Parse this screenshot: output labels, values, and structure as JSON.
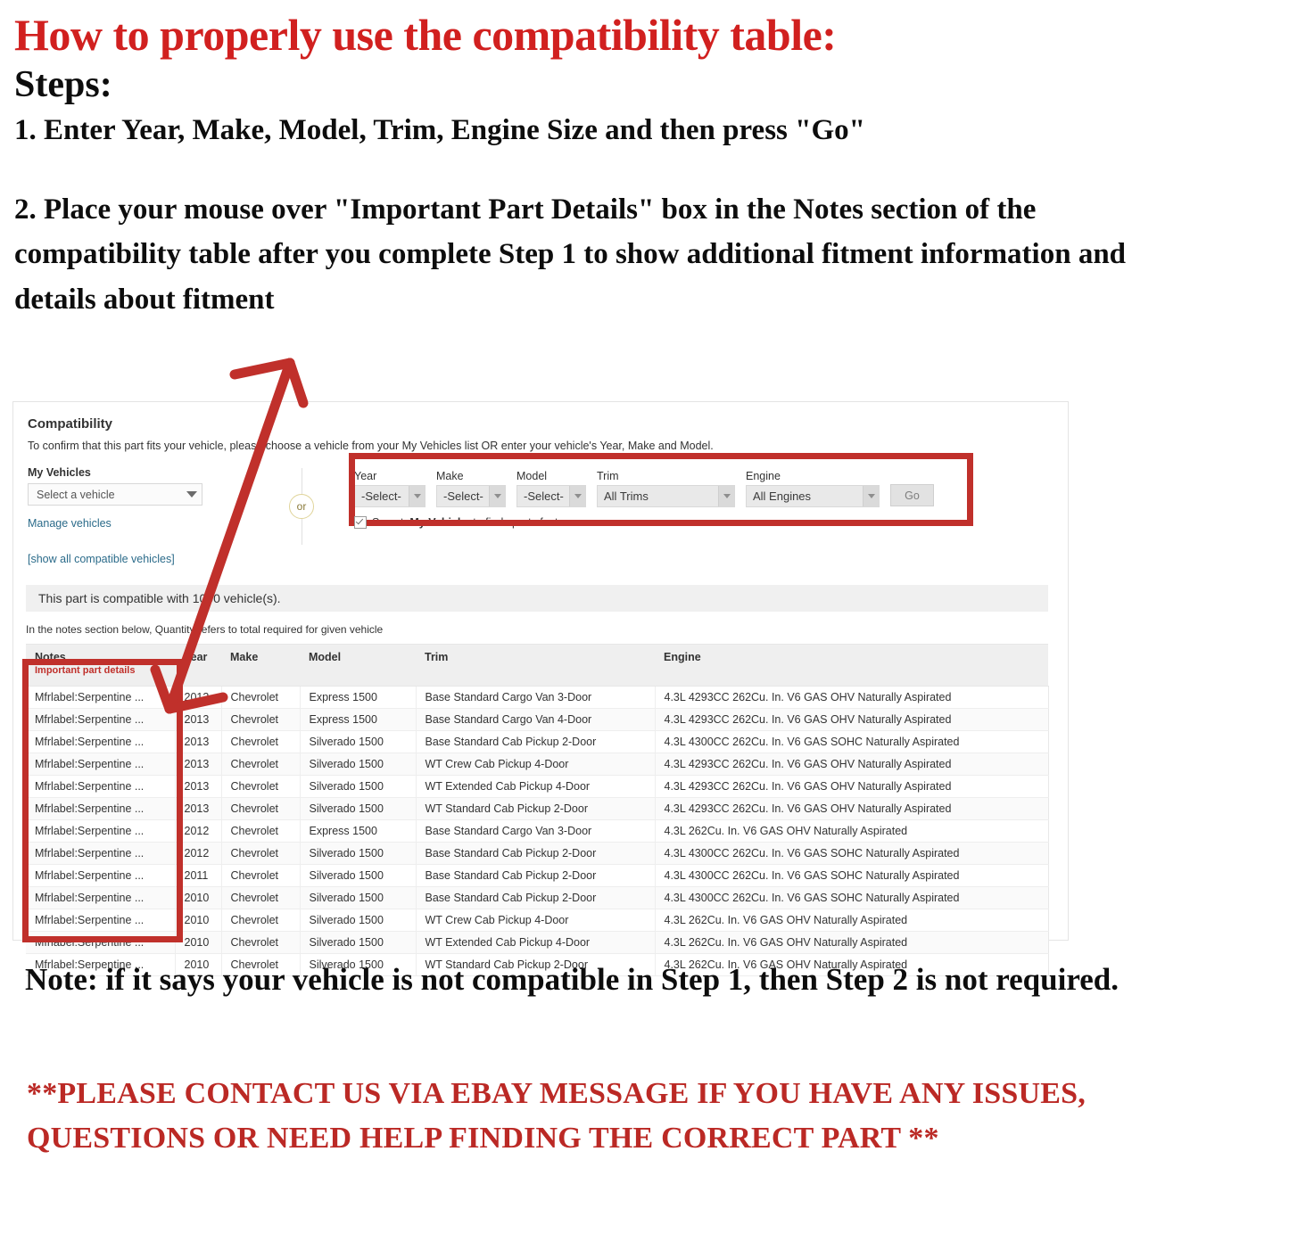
{
  "instructions": {
    "heading": "How to properly use the compatibility table:",
    "steps_label": "Steps:",
    "step1": "1. Enter Year, Make, Model, Trim, Engine Size and then press \"Go\"",
    "step2": "2. Place your mouse over \"Important Part Details\" box in the Notes section of the compatibility table after you complete Step 1 to show additional fitment information and details about fitment"
  },
  "compat": {
    "title": "Compatibility",
    "subtitle": "To confirm that this part fits your vehicle, please choose a vehicle from your My Vehicles list OR enter your vehicle's Year, Make and Model.",
    "my_vehicles_label": "My Vehicles",
    "my_vehicles_value": "Select a vehicle",
    "manage_vehicles_link": "Manage vehicles",
    "show_all_link": "[show all compatible vehicles]",
    "or_label": "or",
    "fields": {
      "year": {
        "label": "Year",
        "value": "-Select-"
      },
      "make": {
        "label": "Make",
        "value": "-Select-"
      },
      "model": {
        "label": "Model",
        "value": "-Select-"
      },
      "trim": {
        "label": "Trim",
        "value": "All Trims"
      },
      "engine": {
        "label": "Engine",
        "value": "All Engines"
      }
    },
    "go_button": "Go",
    "save_checkbox": {
      "prefix": "Save to ",
      "bold": "My Vehicles",
      "suffix": " to finds parts faster",
      "checked": true
    },
    "compatible_bar": "This part is compatible with 1000 vehicle(s).",
    "notes_hint": "In the notes section below, Quantity refers to total required for given vehicle",
    "table": {
      "columns": [
        "Notes",
        "Year",
        "Make",
        "Model",
        "Trim",
        "Engine"
      ],
      "notes_subheader": "Important part details",
      "rows": [
        {
          "notes": "Mfrlabel:Serpentine ...",
          "year": "2013",
          "make": "Chevrolet",
          "model": "Express 1500",
          "trim": "Base Standard Cargo Van 3-Door",
          "engine": "4.3L 4293CC 262Cu. In. V6 GAS OHV Naturally Aspirated"
        },
        {
          "notes": "Mfrlabel:Serpentine ...",
          "year": "2013",
          "make": "Chevrolet",
          "model": "Express 1500",
          "trim": "Base Standard Cargo Van 4-Door",
          "engine": "4.3L 4293CC 262Cu. In. V6 GAS OHV Naturally Aspirated"
        },
        {
          "notes": "Mfrlabel:Serpentine ...",
          "year": "2013",
          "make": "Chevrolet",
          "model": "Silverado 1500",
          "trim": "Base Standard Cab Pickup 2-Door",
          "engine": "4.3L 4300CC 262Cu. In. V6 GAS SOHC Naturally Aspirated"
        },
        {
          "notes": "Mfrlabel:Serpentine ...",
          "year": "2013",
          "make": "Chevrolet",
          "model": "Silverado 1500",
          "trim": "WT Crew Cab Pickup 4-Door",
          "engine": "4.3L 4293CC 262Cu. In. V6 GAS OHV Naturally Aspirated"
        },
        {
          "notes": "Mfrlabel:Serpentine ...",
          "year": "2013",
          "make": "Chevrolet",
          "model": "Silverado 1500",
          "trim": "WT Extended Cab Pickup 4-Door",
          "engine": "4.3L 4293CC 262Cu. In. V6 GAS OHV Naturally Aspirated"
        },
        {
          "notes": "Mfrlabel:Serpentine ...",
          "year": "2013",
          "make": "Chevrolet",
          "model": "Silverado 1500",
          "trim": "WT Standard Cab Pickup 2-Door",
          "engine": "4.3L 4293CC 262Cu. In. V6 GAS OHV Naturally Aspirated"
        },
        {
          "notes": "Mfrlabel:Serpentine ...",
          "year": "2012",
          "make": "Chevrolet",
          "model": "Express 1500",
          "trim": "Base Standard Cargo Van 3-Door",
          "engine": "4.3L 262Cu. In. V6 GAS OHV Naturally Aspirated"
        },
        {
          "notes": "Mfrlabel:Serpentine ...",
          "year": "2012",
          "make": "Chevrolet",
          "model": "Silverado 1500",
          "trim": "Base Standard Cab Pickup 2-Door",
          "engine": "4.3L 4300CC 262Cu. In. V6 GAS SOHC Naturally Aspirated"
        },
        {
          "notes": "Mfrlabel:Serpentine ...",
          "year": "2011",
          "make": "Chevrolet",
          "model": "Silverado 1500",
          "trim": "Base Standard Cab Pickup 2-Door",
          "engine": "4.3L 4300CC 262Cu. In. V6 GAS SOHC Naturally Aspirated"
        },
        {
          "notes": "Mfrlabel:Serpentine ...",
          "year": "2010",
          "make": "Chevrolet",
          "model": "Silverado 1500",
          "trim": "Base Standard Cab Pickup 2-Door",
          "engine": "4.3L 4300CC 262Cu. In. V6 GAS SOHC Naturally Aspirated"
        },
        {
          "notes": "Mfrlabel:Serpentine ...",
          "year": "2010",
          "make": "Chevrolet",
          "model": "Silverado 1500",
          "trim": "WT Crew Cab Pickup 4-Door",
          "engine": "4.3L 262Cu. In. V6 GAS OHV Naturally Aspirated"
        },
        {
          "notes": "Mfrlabel:Serpentine ...",
          "year": "2010",
          "make": "Chevrolet",
          "model": "Silverado 1500",
          "trim": "WT Extended Cab Pickup 4-Door",
          "engine": "4.3L 262Cu. In. V6 GAS OHV Naturally Aspirated"
        },
        {
          "notes": "Mfrlabel:Serpentine ...",
          "year": "2010",
          "make": "Chevrolet",
          "model": "Silverado 1500",
          "trim": "WT Standard Cab Pickup 2-Door",
          "engine": "4.3L 262Cu. In. V6 GAS OHV Naturally Aspirated"
        }
      ]
    }
  },
  "footer": {
    "note": "Note: if it says your vehicle is not compatible in Step 1, then Step 2 is not required.",
    "contact": "**PLEASE CONTACT US VIA EBAY MESSAGE IF YOU HAVE ANY ISSUES, QUESTIONS OR NEED HELP FINDING THE CORRECT PART **"
  },
  "colors": {
    "heading_red": "#d1201f",
    "highlight_red": "#c0302b",
    "contact_red": "#bb2925",
    "link_blue": "#2b6b8a"
  }
}
